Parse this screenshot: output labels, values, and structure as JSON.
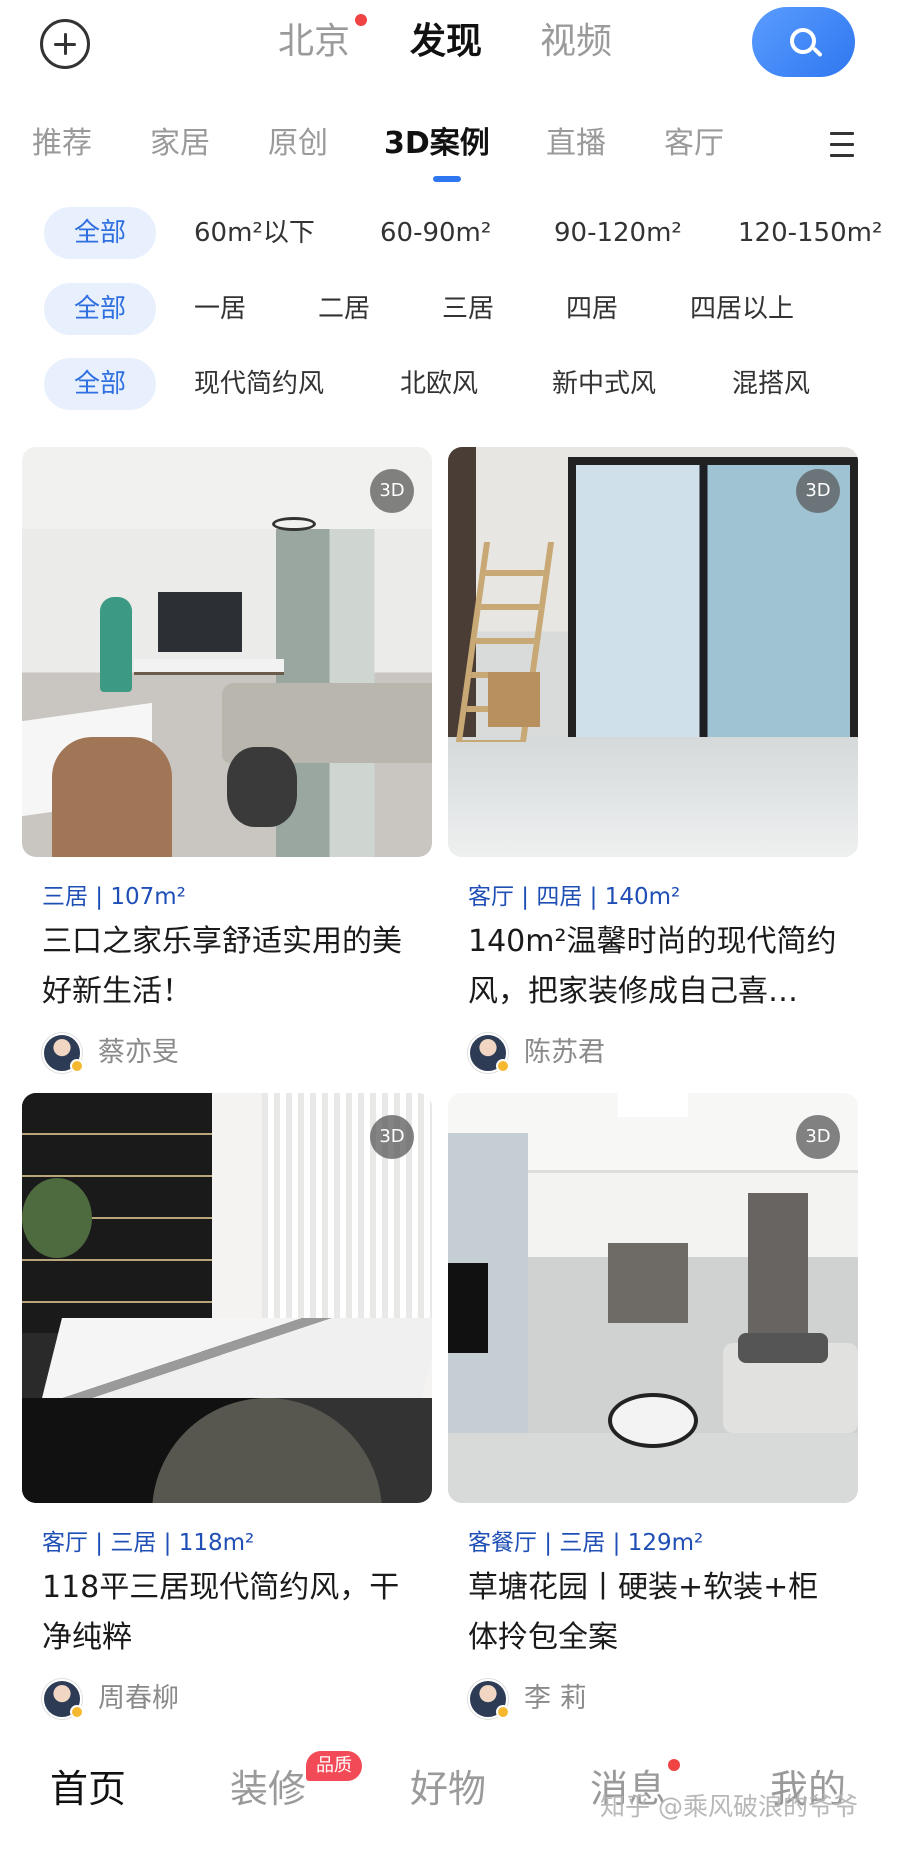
{
  "top": {
    "city": "北京",
    "discover": "发现",
    "video": "视频"
  },
  "categories": [
    "推荐",
    "家居",
    "原创",
    "3D案例",
    "直播",
    "客厅"
  ],
  "filters": {
    "area": [
      "全部",
      "60m²以下",
      "60-90m²",
      "90-120m²",
      "120-150m²"
    ],
    "rooms": [
      "全部",
      "一居",
      "二居",
      "三居",
      "四居",
      "四居以上"
    ],
    "style": [
      "全部",
      "现代简约风",
      "北欧风",
      "新中式风",
      "混搭风"
    ]
  },
  "cards": [
    {
      "badge": "3D",
      "tags": "三居 | 107m²",
      "title": "三口之家乐享舒适实用的美好新生活！",
      "author": "蔡亦旻"
    },
    {
      "badge": "3D",
      "tags": "客厅 | 四居 | 140m²",
      "title": "140m²温馨时尚的现代简约风，把家装修成自己喜…",
      "author": "陈苏君"
    },
    {
      "badge": "3D",
      "tags": "客厅 | 三居 | 118m²",
      "title": "118平三居现代简约风，干净纯粹",
      "author": "周春柳"
    },
    {
      "badge": "3D",
      "tags": "客餐厅 | 三居 | 129m²",
      "title": "草塘花园丨硬装+软装+柜体拎包全案",
      "author": "李 莉"
    }
  ],
  "nav": {
    "home": "首页",
    "decoration": "装修",
    "quality_badge": "品质",
    "goods": "好物",
    "messages": "消息",
    "me": "我的"
  },
  "watermark": "知乎 @乘风破浪的爷爷",
  "colors": {
    "accent": "#2f77f0",
    "tag_blue": "#1f4fb5",
    "chip_bg": "#e8f0fd",
    "dot_red": "#f04444"
  }
}
